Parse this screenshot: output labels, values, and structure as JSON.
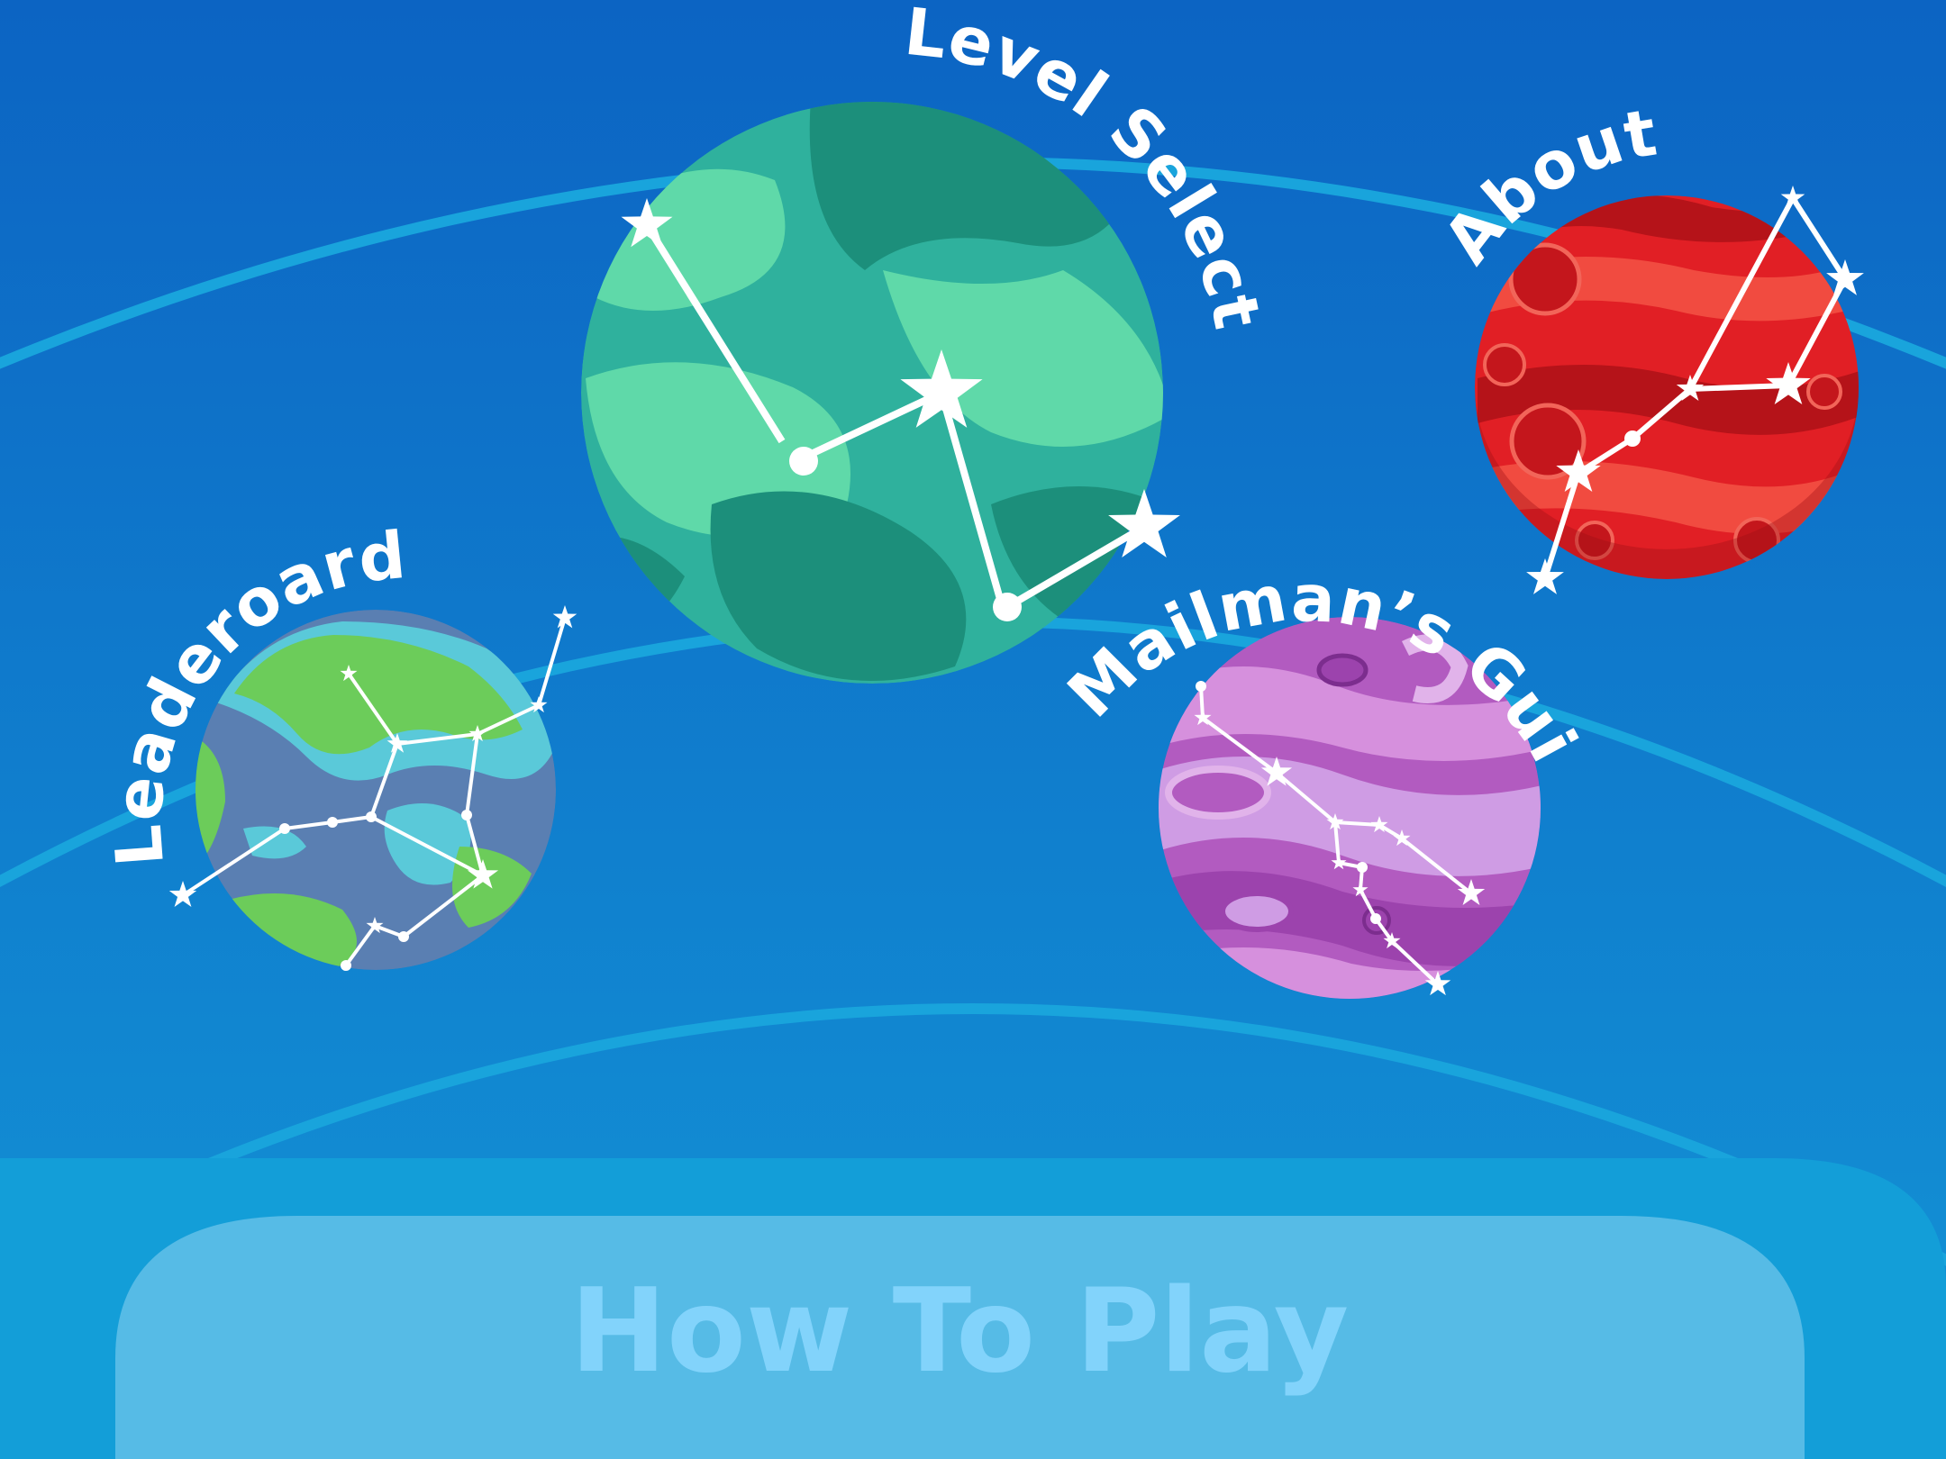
{
  "menu": {
    "level_select": "Level Select",
    "about": "About",
    "leaderboard": "Leaderoard",
    "mailmans_guide": "Mailman’s Guide",
    "how_to_play": "How To Play"
  },
  "colors": {
    "background_top": "#0c66c4",
    "background_bottom": "#1290d4",
    "orbit_line": "#19a4dc",
    "label_text": "#ffffff",
    "how_to_play_panel": "#56bbe6",
    "how_to_play_text": "#82d3fb",
    "planet_green": "#3cb9a0",
    "planet_red": "#e4262a",
    "planet_earth": "#5a7fb2",
    "planet_purple": "#b15bbf"
  },
  "icons": [
    "green-planet-icon",
    "red-planet-icon",
    "earth-planet-icon",
    "purple-planet-icon",
    "constellation-icon"
  ]
}
